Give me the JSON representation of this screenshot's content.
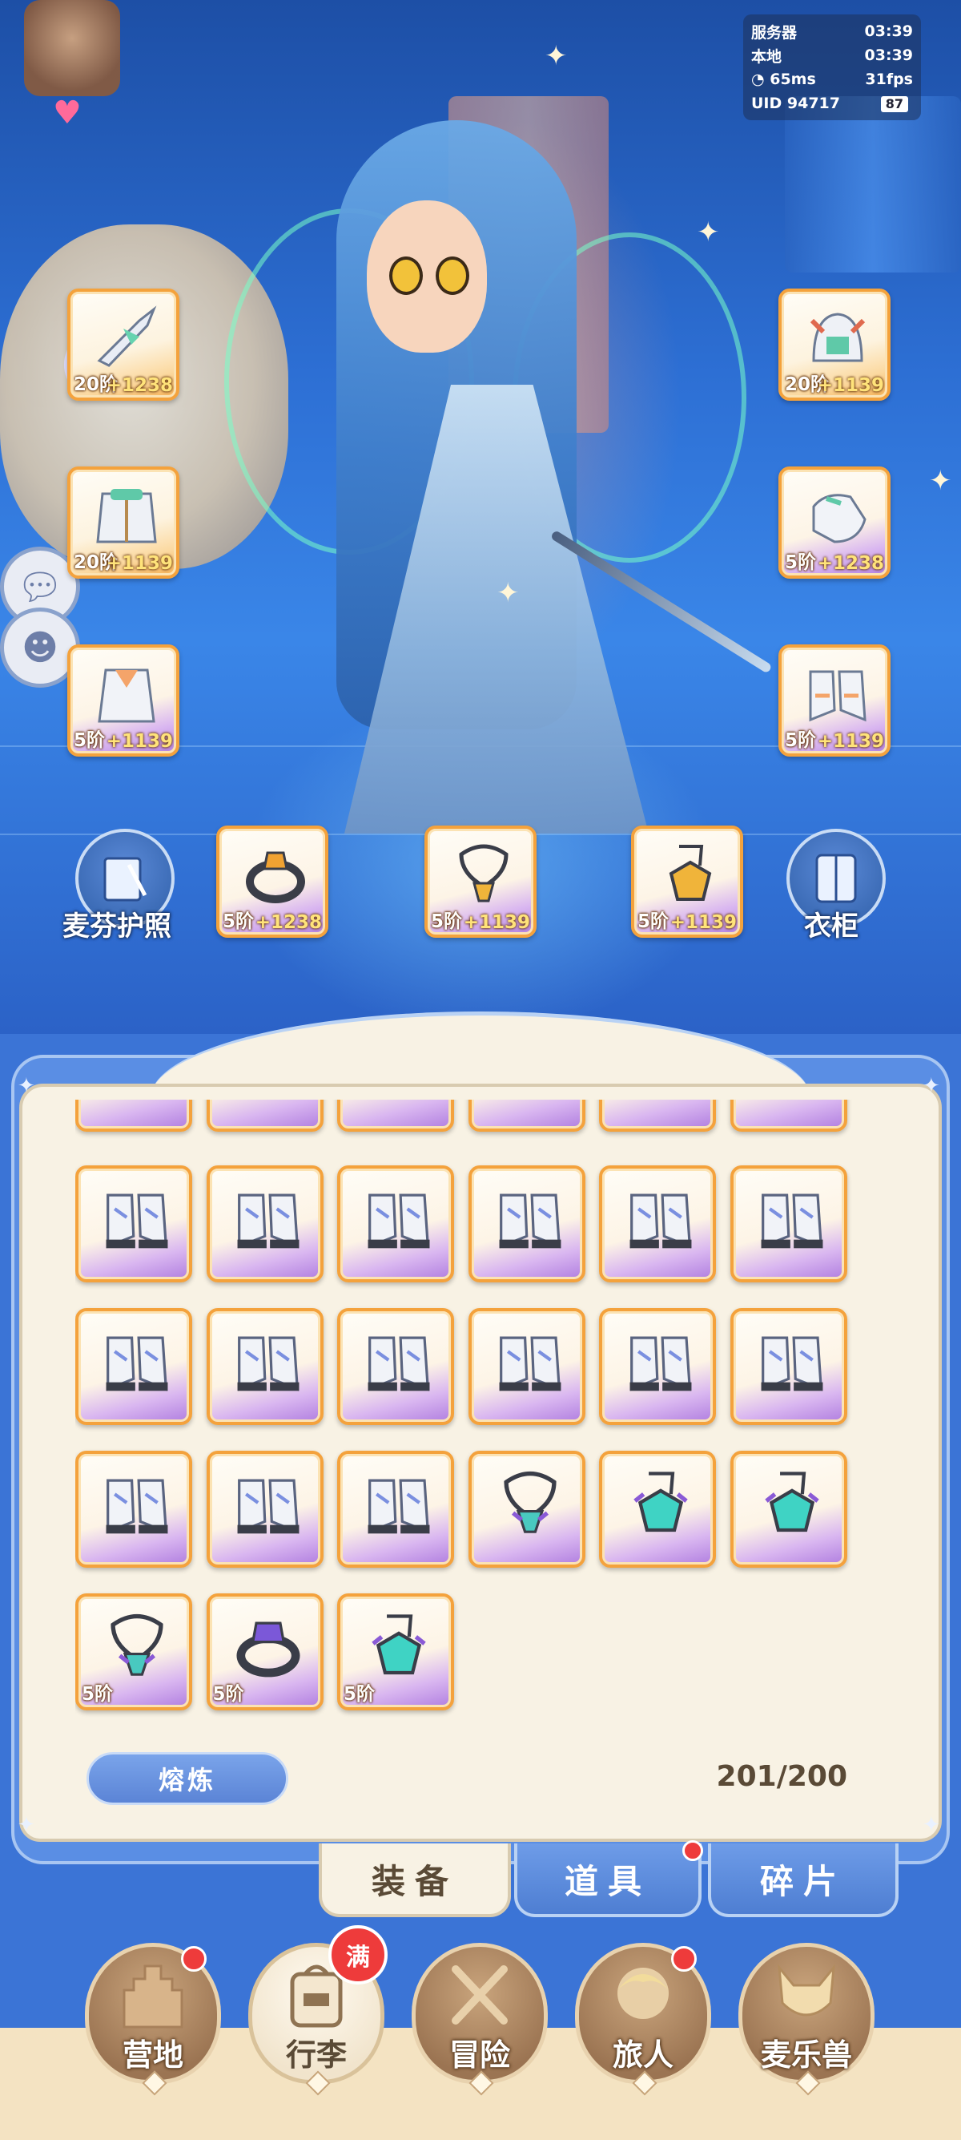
{
  "status": {
    "server_label": "服务器",
    "server_time": "03:39",
    "local_label": "本地",
    "local_time": "03:39",
    "ping": "65ms",
    "fps": "31fps",
    "uid": "UID 94717",
    "battery": "87"
  },
  "equipped": {
    "left": [
      {
        "name": "weapon",
        "level": "20阶",
        "bonus": "+1238",
        "frame": "gold"
      },
      {
        "name": "armor",
        "level": "20阶",
        "bonus": "+1139",
        "frame": "gold"
      },
      {
        "name": "cape",
        "level": "5阶",
        "bonus": "+1139",
        "frame": "purple"
      }
    ],
    "right": [
      {
        "name": "helmet",
        "level": "20阶",
        "bonus": "+1139",
        "frame": "gold"
      },
      {
        "name": "gloves",
        "level": "5阶",
        "bonus": "+1238",
        "frame": "purple"
      },
      {
        "name": "boots",
        "level": "5阶",
        "bonus": "+1139",
        "frame": "purple"
      }
    ],
    "accessories": [
      {
        "name": "ring",
        "level": "5阶",
        "bonus": "+1238"
      },
      {
        "name": "necklace",
        "level": "5阶",
        "bonus": "+1139"
      },
      {
        "name": "pendant",
        "level": "5阶",
        "bonus": "+1139"
      }
    ]
  },
  "buttons": {
    "passport": "麦芬护照",
    "wardrobe": "衣柜",
    "smelt": "熔炼"
  },
  "inventory": {
    "capacity": "201/200",
    "items": [
      {
        "type": "boots",
        "level": ""
      },
      {
        "type": "boots",
        "level": ""
      },
      {
        "type": "boots",
        "level": ""
      },
      {
        "type": "boots",
        "level": ""
      },
      {
        "type": "boots",
        "level": ""
      },
      {
        "type": "boots",
        "level": ""
      },
      {
        "type": "boots",
        "level": ""
      },
      {
        "type": "boots",
        "level": ""
      },
      {
        "type": "boots",
        "level": ""
      },
      {
        "type": "boots",
        "level": ""
      },
      {
        "type": "boots",
        "level": ""
      },
      {
        "type": "boots",
        "level": ""
      },
      {
        "type": "boots",
        "level": ""
      },
      {
        "type": "boots",
        "level": ""
      },
      {
        "type": "boots",
        "level": ""
      },
      {
        "type": "necklace",
        "level": ""
      },
      {
        "type": "pendant",
        "level": ""
      },
      {
        "type": "pendant",
        "level": ""
      },
      {
        "type": "necklace",
        "level": "5阶"
      },
      {
        "type": "ring",
        "level": "5阶"
      },
      {
        "type": "pendant",
        "level": "5阶"
      }
    ]
  },
  "tabs": [
    {
      "label": "装备",
      "active": true
    },
    {
      "label": "道具",
      "active": false
    },
    {
      "label": "碎片",
      "active": false
    }
  ],
  "nav": [
    {
      "label": "营地",
      "icon": "castle-icon"
    },
    {
      "label": "行李",
      "icon": "backpack-icon"
    },
    {
      "label": "冒险",
      "icon": "crossed-swords-icon"
    },
    {
      "label": "旅人",
      "icon": "traveler-icon"
    },
    {
      "label": "麦乐兽",
      "icon": "pet-icon"
    }
  ],
  "badges": {
    "bag_full": "满"
  }
}
